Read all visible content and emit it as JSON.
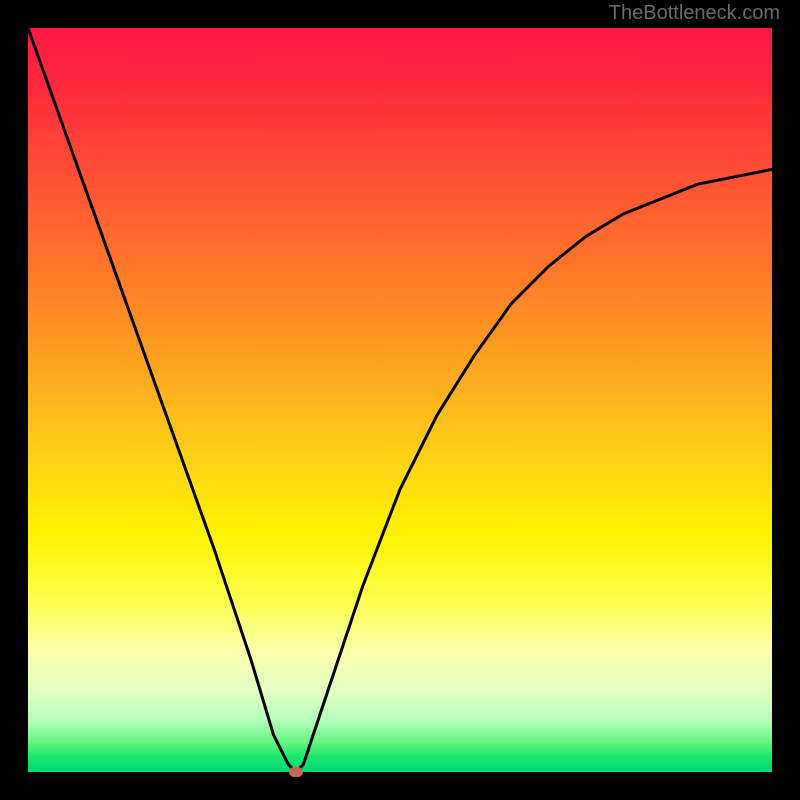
{
  "watermark": "TheBottleneck.com",
  "chart_data": {
    "type": "line",
    "title": "",
    "xlabel": "",
    "ylabel": "",
    "xlim": [
      0,
      100
    ],
    "ylim": [
      0,
      100
    ],
    "series": [
      {
        "name": "curve",
        "x": [
          0,
          5,
          10,
          15,
          20,
          25,
          30,
          33,
          35,
          36,
          37,
          40,
          45,
          50,
          55,
          60,
          65,
          70,
          75,
          80,
          85,
          90,
          95,
          100
        ],
        "y": [
          100,
          86,
          72,
          58,
          44,
          30,
          15,
          5,
          1,
          0,
          1,
          10,
          25,
          38,
          48,
          56,
          63,
          68,
          72,
          75,
          77,
          79,
          80,
          81
        ]
      }
    ],
    "marker": {
      "x": 36,
      "y": 0
    },
    "background_gradient": {
      "top": "#ff1744",
      "mid": "#ffd217",
      "bottom": "#00d97c"
    }
  }
}
